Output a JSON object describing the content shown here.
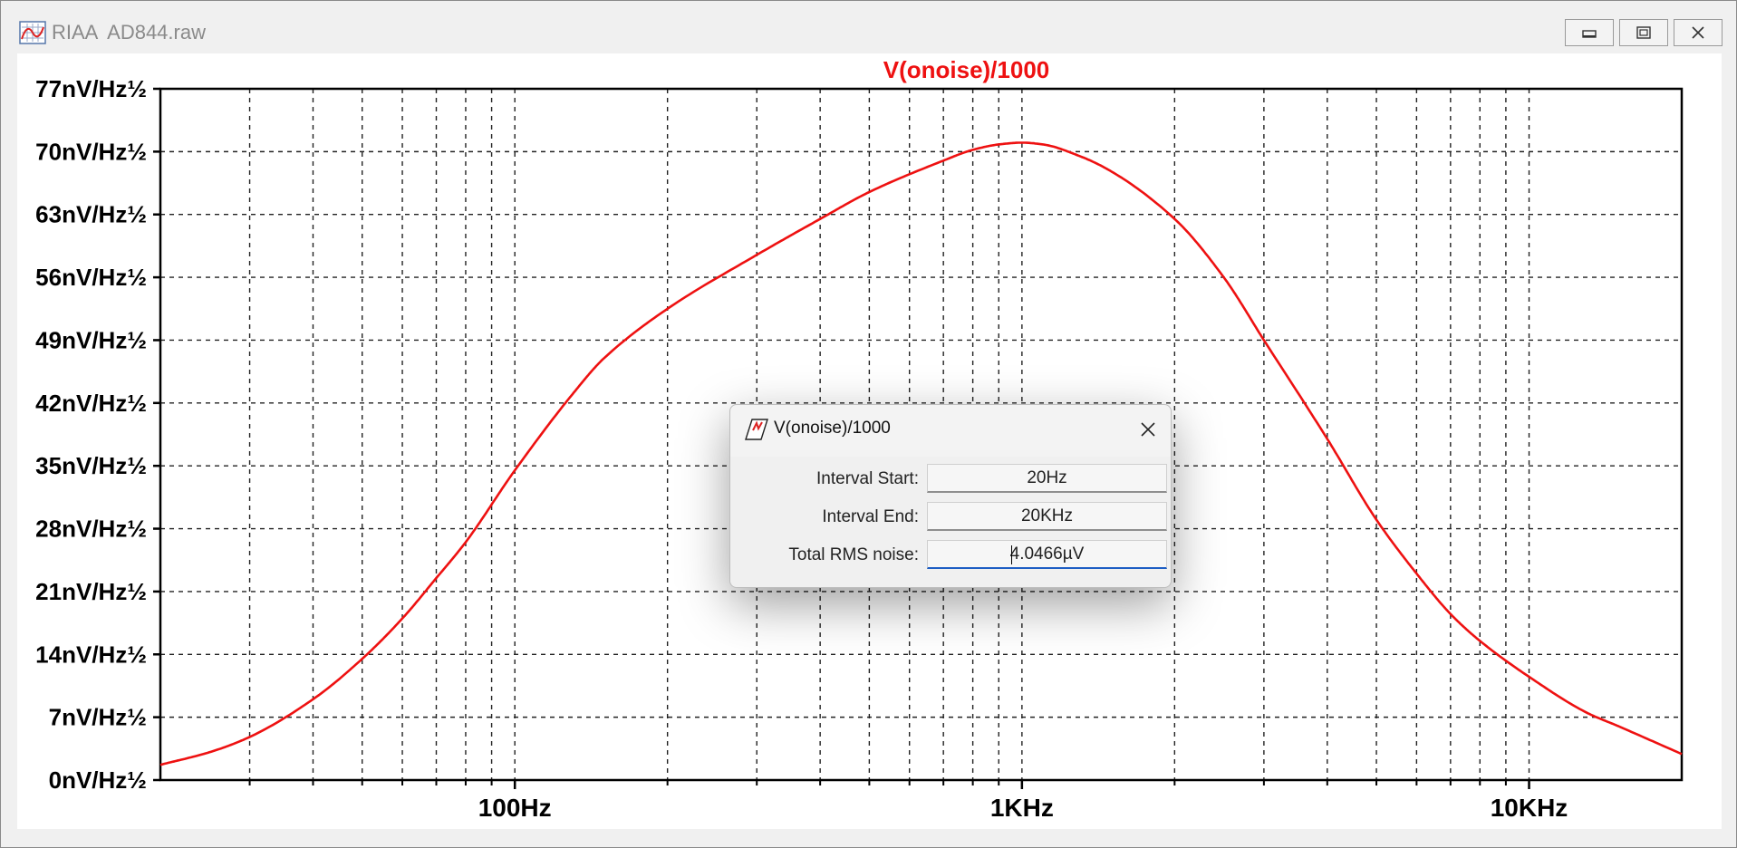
{
  "window": {
    "title": "RIAA  AD844.raw",
    "icon": "waveform-plot-icon",
    "buttons": [
      "minimize-icon",
      "maximize-icon",
      "close-icon"
    ]
  },
  "chart_data": {
    "type": "line",
    "title": "V(onoise)/1000",
    "color": "#ee1111",
    "x_scale": "log",
    "xlim": [
      20,
      20000
    ],
    "ylim": [
      0,
      77
    ],
    "grid": true,
    "x_ticks": [
      {
        "value": 100,
        "label": "100Hz"
      },
      {
        "value": 1000,
        "label": "1KHz"
      },
      {
        "value": 10000,
        "label": "10KHz"
      }
    ],
    "y_ticks": [
      {
        "value": 77,
        "label": "77nV/Hz½"
      },
      {
        "value": 70,
        "label": "70nV/Hz½"
      },
      {
        "value": 63,
        "label": "63nV/Hz½"
      },
      {
        "value": 56,
        "label": "56nV/Hz½"
      },
      {
        "value": 49,
        "label": "49nV/Hz½"
      },
      {
        "value": 42,
        "label": "42nV/Hz½"
      },
      {
        "value": 35,
        "label": "35nV/Hz½"
      },
      {
        "value": 28,
        "label": "28nV/Hz½"
      },
      {
        "value": 21,
        "label": "21nV/Hz½"
      },
      {
        "value": 14,
        "label": "14nV/Hz½"
      },
      {
        "value": 7,
        "label": "7nV/Hz½"
      },
      {
        "value": 0,
        "label": "0nV/Hz½"
      }
    ],
    "series": [
      {
        "x": [
          20,
          25,
          30,
          40,
          50,
          60,
          70,
          80,
          100,
          130,
          150,
          200,
          300,
          400,
          500,
          700,
          800,
          900,
          1000,
          1100,
          1300,
          1500,
          2000,
          2500,
          3000,
          4000,
          5000,
          6000,
          7000,
          8000,
          10000,
          13000,
          15000,
          20000
        ],
        "y": [
          1.7,
          3.1,
          4.8,
          9.0,
          13.5,
          18.0,
          22.5,
          26.5,
          34.5,
          43.0,
          47.0,
          52.5,
          58.5,
          62.5,
          65.5,
          69.0,
          70.2,
          70.8,
          71.0,
          70.8,
          69.5,
          67.8,
          62.5,
          56.0,
          49.0,
          38.0,
          29.0,
          23.0,
          18.5,
          15.5,
          11.5,
          7.5,
          6.0,
          2.9
        ]
      }
    ]
  },
  "dialog": {
    "icon": "waveform-plot-icon",
    "title": "V(onoise)/1000",
    "rows": [
      {
        "label": "Interval Start:",
        "value": "20Hz"
      },
      {
        "label": "Interval End:",
        "value": "20KHz"
      },
      {
        "label": "Total RMS noise:",
        "value": "4.0466µV"
      }
    ]
  }
}
